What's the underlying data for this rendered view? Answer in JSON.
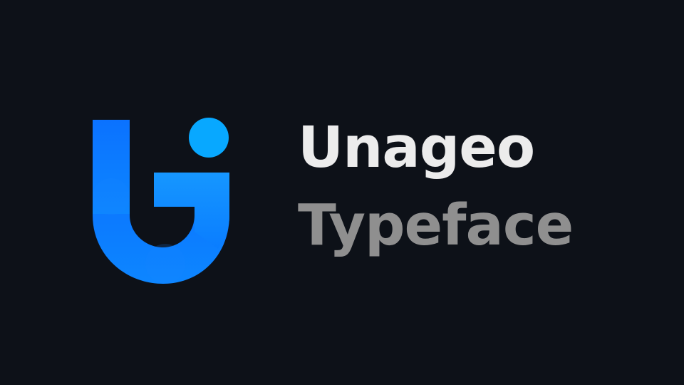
{
  "brand": {
    "title": "Unageo",
    "subtitle": "Typeface",
    "logo_icon": "unageo-logo-icon"
  },
  "colors": {
    "background": "#0d1118",
    "title": "#ececec",
    "subtitle": "#8f8f8f",
    "logo_primary": "#0e7bff",
    "logo_secondary": "#1f96ff",
    "logo_dot": "#08a8ff"
  }
}
